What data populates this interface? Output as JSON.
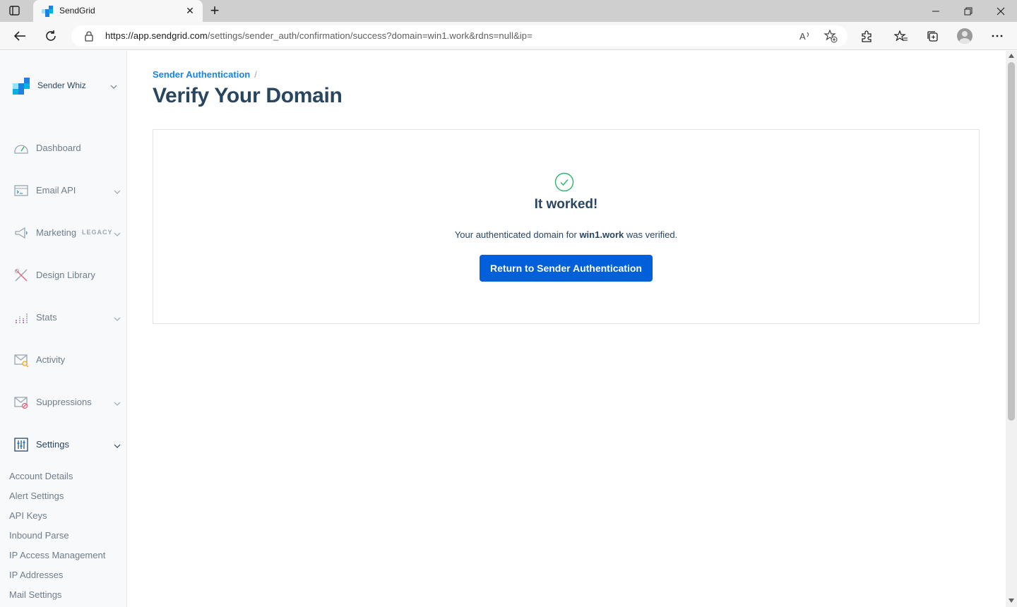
{
  "browser": {
    "tab_title": "SendGrid",
    "close_tab_glyph": "✕",
    "new_tab_glyph": "+",
    "url_host": "https://app.sendgrid.com",
    "url_path": "/settings/sender_auth/confirmation/success?domain=win1.work&rdns=null&ip="
  },
  "sidebar": {
    "account_name": "Sender Whiz",
    "nav": [
      {
        "label": "Dashboard"
      },
      {
        "label": "Email API"
      },
      {
        "label": "Marketing",
        "badge": "LEGACY"
      },
      {
        "label": "Design Library"
      },
      {
        "label": "Stats"
      },
      {
        "label": "Activity"
      },
      {
        "label": "Suppressions"
      },
      {
        "label": "Settings"
      }
    ],
    "settings_items": [
      "Account Details",
      "Alert Settings",
      "API Keys",
      "Inbound Parse",
      "IP Access Management",
      "IP Addresses",
      "Mail Settings"
    ]
  },
  "main": {
    "breadcrumb": "Sender Authentication",
    "breadcrumb_sep": "/",
    "title": "Verify Your Domain",
    "card": {
      "heading": "It worked!",
      "message_prefix": "Your authenticated domain for",
      "domain": "win1.work",
      "message_suffix": "was verified.",
      "button_label": "Return to Sender Authentication"
    }
  },
  "colors": {
    "accent": "#0160d9",
    "link": "#1a82e2",
    "success": "#2db36a",
    "text": "#294661"
  }
}
